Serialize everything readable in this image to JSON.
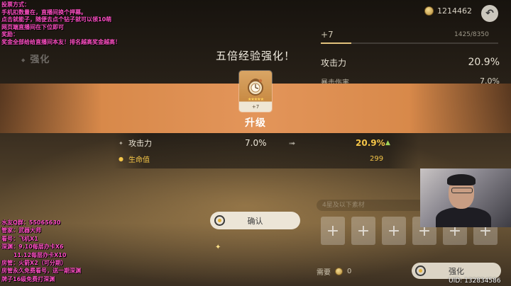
{
  "top_bar": {
    "currency": "1214462",
    "back_icon": "return-arrow-icon"
  },
  "weapon_panel": {
    "level": "+7",
    "exp": "1425/8350",
    "exp_fraction": 0.171,
    "stats": [
      {
        "name": "攻击力",
        "value": "20.9%"
      },
      {
        "name": "暴击伤害",
        "value": "7.0%"
      }
    ]
  },
  "tab": {
    "label": "强化"
  },
  "popup": {
    "title": "五倍经验强化！",
    "card": {
      "stars": "★★★★★",
      "level": "+7",
      "icon": "pocket-watch-icon"
    },
    "upgrade_label": "升级",
    "comparisons": [
      {
        "name": "攻击力",
        "old": "7.0%",
        "new": "20.9%"
      },
      {
        "name": "生命值",
        "old": "",
        "new": "299"
      }
    ],
    "confirm_label": "确认"
  },
  "materials": {
    "filter_placeholder": "4星及以下素材",
    "slots": [
      "+",
      "+",
      "+",
      "+",
      "+",
      "+"
    ],
    "cost_label": "需要",
    "cost_value": "0",
    "strengthen_label": "强化"
  },
  "stream": {
    "uid": "UID: 132834586",
    "overlay_top": [
      "投票方式：",
      "手机扣数量在，直播间换个押幕。",
      "点击就能子，随便去点个钻子就可以领10萌",
      "网页端直播间在下位即可",
      "奖励：",
      "奖金全部给给直播间本友！排名越高奖金越高！"
    ],
    "overlay_bottom": [
      "水友Q群：55065630",
      "管家：武器大师",
      "看号：飞机X1",
      "深渊：9.10每层办卡X6",
      "      11.12每层办卡X10",
      "房管：火箭X2（可分期）",
      "房管永久免费看号，送一期深渊",
      "牌子16级免费打深渊"
    ]
  }
}
